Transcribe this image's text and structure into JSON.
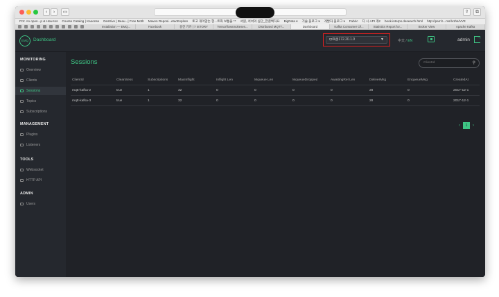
{
  "browser": {
    "bookmarks": [
      "FIX: An open...p & How-tos",
      "Course Catalog | Kaoonse",
      "Destrive | Beau...| Free Moth",
      "Maven Reposi...etacExplore",
      "토고 개이앞는 현...트와 보통을 **",
      "서원, 서석의 심단_한결백하요",
      "BigData ▾",
      "기술 블로그 ▾",
      "개발자 블로그 ▾",
      "Fabric",
      "디 시 API 개2",
      "book.interps.desearch.html",
      "http://parr.b...ms/lx1hs/VVE"
    ],
    "tabs": [
      "Installation — EMQ...",
      "Facebook",
      "용전 기카 | 7 ISTORY",
      "Tensorflowsmokeses...",
      "Distributed MQTT...",
      "Dashboard",
      "Kafka Consumer Of...",
      "Statistics Report for...",
      "Broker View",
      "Apache Kafka"
    ],
    "active_tab": "Dashboard"
  },
  "header": {
    "logo_text": "EMQ",
    "brand": "Dashboard",
    "node": "rpl9@172.20.1.9",
    "lang_zh": "中文",
    "lang_sep": "/",
    "lang_en": "EN",
    "user": "admin"
  },
  "sidebar": {
    "monitoring": {
      "title": "MONITORING",
      "items": [
        {
          "label": "Overview",
          "icon": "chart-icon"
        },
        {
          "label": "Clients",
          "icon": "clients-icon"
        },
        {
          "label": "Sessions",
          "icon": "sessions-icon",
          "active": true
        },
        {
          "label": "Topics",
          "icon": "topics-icon"
        },
        {
          "label": "Subscriptions",
          "icon": "subscriptions-icon"
        }
      ]
    },
    "management": {
      "title": "MANAGEMENT",
      "items": [
        {
          "label": "Plugins",
          "icon": "plugins-icon"
        },
        {
          "label": "Listeners",
          "icon": "listeners-icon"
        }
      ]
    },
    "tools": {
      "title": "TOOLS",
      "items": [
        {
          "label": "Websocket",
          "icon": "websocket-icon"
        },
        {
          "label": "HTTP API",
          "icon": "api-icon"
        }
      ]
    },
    "admin": {
      "title": "ADMIN",
      "items": [
        {
          "label": "Users",
          "icon": "users-icon"
        }
      ]
    }
  },
  "main": {
    "title": "Sessions",
    "search_placeholder": "ClientId",
    "columns": [
      "ClientId",
      "CleanSess",
      "Subscriptions",
      "MaxInflight",
      "Inflight Len",
      "Mqueue Len",
      "MqueueDropped",
      "AwaitingRel Len",
      "DeliverMsg",
      "EnqueueMsg",
      "CreatedAt"
    ],
    "rows": [
      [
        "mqtt-kafka-2",
        "true",
        "1",
        "32",
        "0",
        "0",
        "0",
        "0",
        "28",
        "0",
        "2017-12-1"
      ],
      [
        "mqtt-kafka-3",
        "true",
        "1",
        "32",
        "0",
        "0",
        "0",
        "0",
        "28",
        "0",
        "2017-12-1"
      ]
    ],
    "pager": {
      "prev": "‹",
      "page": "1",
      "next": "›"
    }
  },
  "colors": {
    "accent": "#3ec484",
    "highlight": "#e02020"
  }
}
